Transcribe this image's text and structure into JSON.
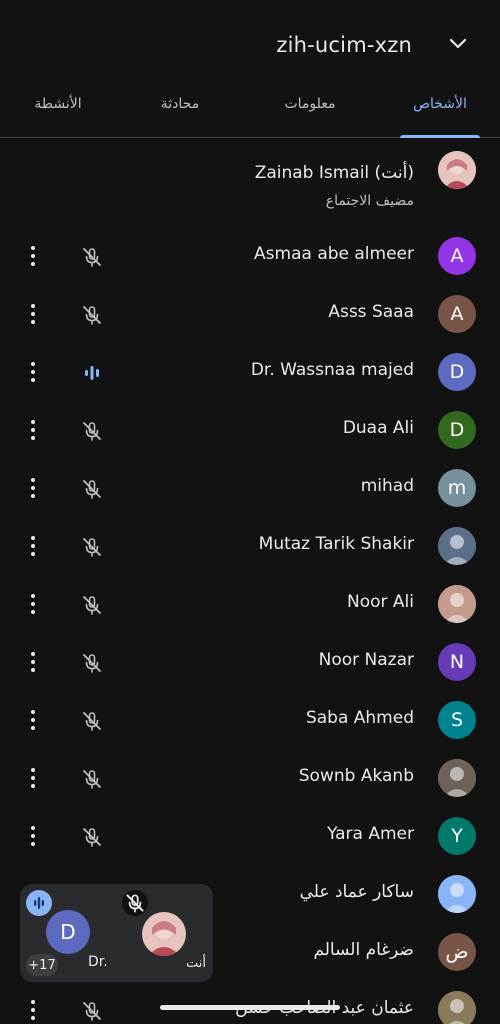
{
  "header": {
    "meeting_code": "zih-ucim-xzn"
  },
  "tabs": [
    {
      "label": "الأشخاص",
      "active": true
    },
    {
      "label": "معلومات",
      "active": false
    },
    {
      "label": "محادثة",
      "active": false
    },
    {
      "label": "الأنشطة",
      "active": false
    }
  ],
  "host": {
    "name": "Zainab Ismail (أنت)",
    "role": "مضيف الاجتماع",
    "avatar": "photo"
  },
  "participants": [
    {
      "name": "Asmaa abe almeer",
      "initial": "A",
      "color": "#9334e6",
      "mic": "muted"
    },
    {
      "name": "Asss Saaa",
      "initial": "A",
      "color": "#795548",
      "mic": "muted"
    },
    {
      "name": "Dr. Wassnaa majed",
      "initial": "D",
      "color": "#5c6bc0",
      "mic": "speaking"
    },
    {
      "name": "Duaa Ali",
      "initial": "D",
      "color": "#33691e",
      "mic": "muted"
    },
    {
      "name": "mihad",
      "initial": "m",
      "color": "#78909c",
      "mic": "muted"
    },
    {
      "name": "Mutaz Tarik Shakir",
      "initial": "",
      "color": "#5b6f8a",
      "mic": "muted"
    },
    {
      "name": "Noor Ali",
      "initial": "",
      "color": "#c49a8c",
      "mic": "muted"
    },
    {
      "name": "Noor Nazar",
      "initial": "N",
      "color": "#673ab7",
      "mic": "muted"
    },
    {
      "name": "Saba Ahmed",
      "initial": "S",
      "color": "#00838f",
      "mic": "muted"
    },
    {
      "name": "Sownb Akanb",
      "initial": "",
      "color": "#6d6257",
      "mic": "muted"
    },
    {
      "name": "Yara Amer",
      "initial": "Y",
      "color": "#00796b",
      "mic": "muted"
    },
    {
      "name": "ساكار عماد علي",
      "initial": "",
      "color": "#8ab4f8",
      "mic": "muted"
    },
    {
      "name": "ضرغام السالم",
      "initial": "ض",
      "color": "#795548",
      "mic": "muted"
    },
    {
      "name": "عثمان عبد الصاحب حسن",
      "initial": "",
      "color": "#8a7a5c",
      "mic": "muted"
    }
  ],
  "mini_tiles": {
    "extra_count": "+17",
    "speaker_label": "Dr.",
    "speaker_initial": "D",
    "self_label": "أنت"
  }
}
